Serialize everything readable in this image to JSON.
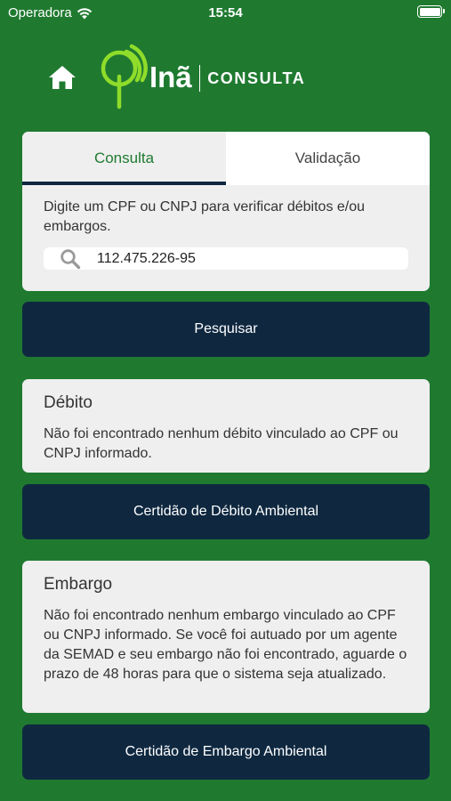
{
  "status_bar": {
    "carrier": "Operadora",
    "time": "15:54"
  },
  "header": {
    "logo_name": "Inã",
    "logo_sub": "CONSULTA",
    "icons": {
      "home": "home-icon",
      "logo": "logo-mark-icon"
    }
  },
  "tabs": [
    {
      "label": "Consulta",
      "active": true
    },
    {
      "label": "Validação",
      "active": false
    }
  ],
  "search": {
    "instruction": "Digite um CPF ou CNPJ para verificar débitos e/ou embargos.",
    "value": "112.475.226-95",
    "icon": "search-icon"
  },
  "buttons": {
    "search": "Pesquisar",
    "debt_certificate": "Certidão de Débito Ambiental",
    "embargo_certificate": "Certidão de Embargo Ambiental"
  },
  "debt": {
    "title": "Débito",
    "text": "Não foi encontrado nenhum débito vinculado ao CPF ou CNPJ informado."
  },
  "embargo": {
    "title": "Embargo",
    "text": "Não foi encontrado nenhum embargo vinculado ao CPF ou CNPJ informado. Se você foi autuado por um agente da SEMAD e seu embargo não foi encontrado, aguarde o prazo de 48 horas para que o sistema seja atualizado."
  },
  "colors": {
    "background": "#1f7a30",
    "button": "#0f2840",
    "card": "#efefef",
    "accent": "#1f7a30",
    "logo_green": "#8fdc2a"
  }
}
